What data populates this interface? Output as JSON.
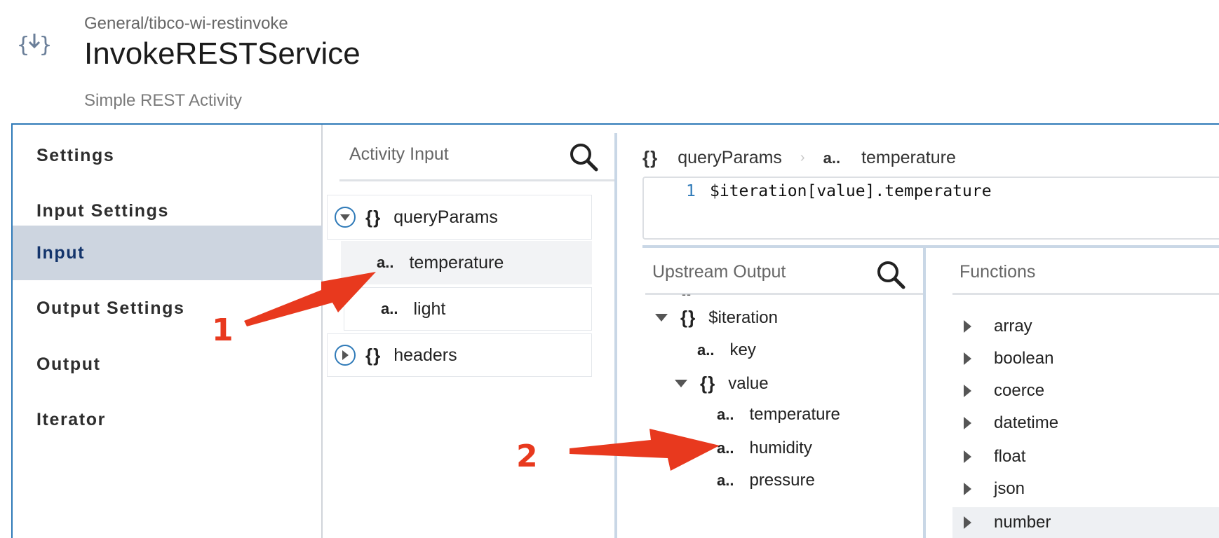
{
  "header": {
    "icon": "braces-download-icon",
    "path": "General/tibco-wi-restinvoke",
    "title": "InvokeRESTService",
    "description": "Simple REST Activity"
  },
  "nav": {
    "items": [
      {
        "label": "Settings"
      },
      {
        "label": "Input Settings"
      },
      {
        "label": "Input",
        "active": true
      },
      {
        "label": "Output Settings"
      },
      {
        "label": "Output"
      },
      {
        "label": "Iterator"
      }
    ]
  },
  "activity_input": {
    "title": "Activity Input",
    "tree": {
      "queryParams": {
        "brace": "{}",
        "label": "queryParams"
      },
      "temperature": {
        "type": "a..",
        "label": "temperature"
      },
      "light": {
        "type": "a..",
        "label": "light"
      },
      "headers": {
        "brace": "{}",
        "label": "headers"
      }
    }
  },
  "mapper": {
    "breadcrumb": {
      "brace": "{}",
      "parent": "queryParams",
      "separator": "›",
      "type": "a..",
      "child": "temperature"
    },
    "editor": {
      "line_number": "1",
      "code": "$iteration[value].temperature"
    }
  },
  "upstream_output": {
    "title": "Upstream Output",
    "dash": "--",
    "tree": {
      "iteration": {
        "brace": "{}",
        "label": "$iteration"
      },
      "key": {
        "type": "a..",
        "label": "key"
      },
      "value": {
        "brace": "{}",
        "label": "value"
      },
      "temperature": {
        "type": "a..",
        "label": "temperature"
      },
      "humidity": {
        "type": "a..",
        "label": "humidity"
      },
      "pressure": {
        "type": "a..",
        "label": "pressure"
      }
    }
  },
  "functions": {
    "title": "Functions",
    "items": [
      "array",
      "boolean",
      "coerce",
      "datetime",
      "float",
      "json",
      "number"
    ]
  },
  "annotations": {
    "marker_1": "1",
    "marker_2": "2",
    "color": "#e8391e"
  },
  "colors": {
    "accent": "#2f7ab8",
    "nav_active_bg": "#cdd5e0",
    "nav_active_text": "#13346b"
  }
}
